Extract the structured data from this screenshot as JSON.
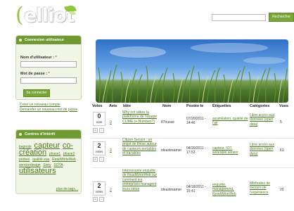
{
  "header": {
    "logo_text": "elliot",
    "search_placeholder": "",
    "search_button": "Rechercher"
  },
  "login": {
    "title": "Connexion utilisateur",
    "username_label": "Nom d'utilisateur :",
    "password_label": "Mot de passe :",
    "required_mark": "*",
    "connect_button": "Se connecter",
    "links": [
      "Créer un nouveau compte",
      "Demander un nouveau mot de passe"
    ]
  },
  "tags": {
    "title": "Centres d'intérêt",
    "items": [
      {
        "text": "bagnole",
        "size": "s"
      },
      {
        "text": "capteur",
        "size": "l"
      },
      {
        "text": "co-création",
        "size": "l"
      },
      {
        "text": "phase1",
        "size": "s"
      },
      {
        "text": "phase2",
        "size": "s"
      },
      {
        "text": "probes",
        "size": "s"
      },
      {
        "text": "qualité eau",
        "size": "s"
      },
      {
        "text": "ReadWriteWeb",
        "size": "s"
      },
      {
        "text": "servicedesign",
        "size": "s"
      },
      {
        "text": "Sony",
        "size": "s"
      },
      {
        "text": "SOTA",
        "size": "s"
      },
      {
        "text": "utilisateurs",
        "size": "l"
      }
    ],
    "more_link": "plus de tags..."
  },
  "table": {
    "headers": {
      "votes": "Votes",
      "avis": "Avis",
      "idee": "Idée",
      "nom": "Nom",
      "postee": "Postée le",
      "etiquettes": "Étiquettes",
      "categories": "Catégories",
      "vues": "Vues"
    },
    "rows": [
      {
        "votes": "0",
        "votes_label": "vote",
        "avis": "0",
        "idee": "Why not utilize la plateforme de l'équipe CLIME (+ Numbeo?)",
        "nom": "87ousse",
        "postee": "07/20/2011 - 14:46",
        "etiquettes": "assimilation, qualité de l'air",
        "categories": "Libre accès aux données (open data)",
        "vues": "5"
      },
      {
        "votes": "2",
        "votes_label": "votes",
        "avis": "3",
        "idee": "Citizen Sensor : un projet de thèse autour de capteurs portables et tracables",
        "nom": "ideastreamer",
        "postee": "04/20/2011 - 17:53",
        "etiquettes": "capteur, IOT, wearable sensor",
        "categories": "Libre accès aux données (open data)",
        "vues": "61"
      },
      {
        "votes": "2",
        "votes_label": "votes",
        "avis": "2",
        "idee": "Intéressante enquête de ReadWriteWeb sur comment les entreprises managent leurs idées",
        "nom": "ideastreamer",
        "postee": "04/18/2011 - 15:41",
        "etiquettes": "enquête, management, ReadWriteWeb",
        "categories": "Méthodes de mesure de l'expérience",
        "vues": "20"
      }
    ]
  }
}
